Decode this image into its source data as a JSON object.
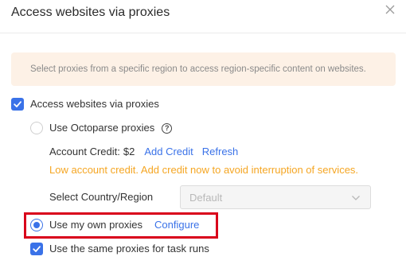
{
  "dialog": {
    "title": "Access websites via proxies",
    "close_icon": "close-icon"
  },
  "notice": {
    "text": "Select proxies from a specific region to access region-specific content on websites."
  },
  "options": {
    "access_via_proxies": {
      "label": "Access websites via proxies",
      "checked": true
    },
    "octoparse_proxies": {
      "label": "Use Octoparse proxies",
      "selected": false,
      "help_icon": "help-icon",
      "help_glyph": "?"
    },
    "account_credit": {
      "label": "Account Credit:",
      "amount": "$2",
      "add_credit": "Add Credit",
      "refresh": "Refresh",
      "warning": "Low account credit. Add credit now to avoid interruption of services."
    },
    "country_region": {
      "label": "Select Country/Region",
      "selected": "Default",
      "disabled": true
    },
    "own_proxies": {
      "label": "Use my own proxies",
      "selected": true,
      "configure": "Configure"
    },
    "same_for_tasks": {
      "label": "Use the same proxies for task runs",
      "checked": true
    }
  },
  "colors": {
    "accent": "#3a72e8",
    "warning": "#f5a623",
    "highlight": "#d9001b",
    "notice_bg": "#fdf1e6"
  }
}
